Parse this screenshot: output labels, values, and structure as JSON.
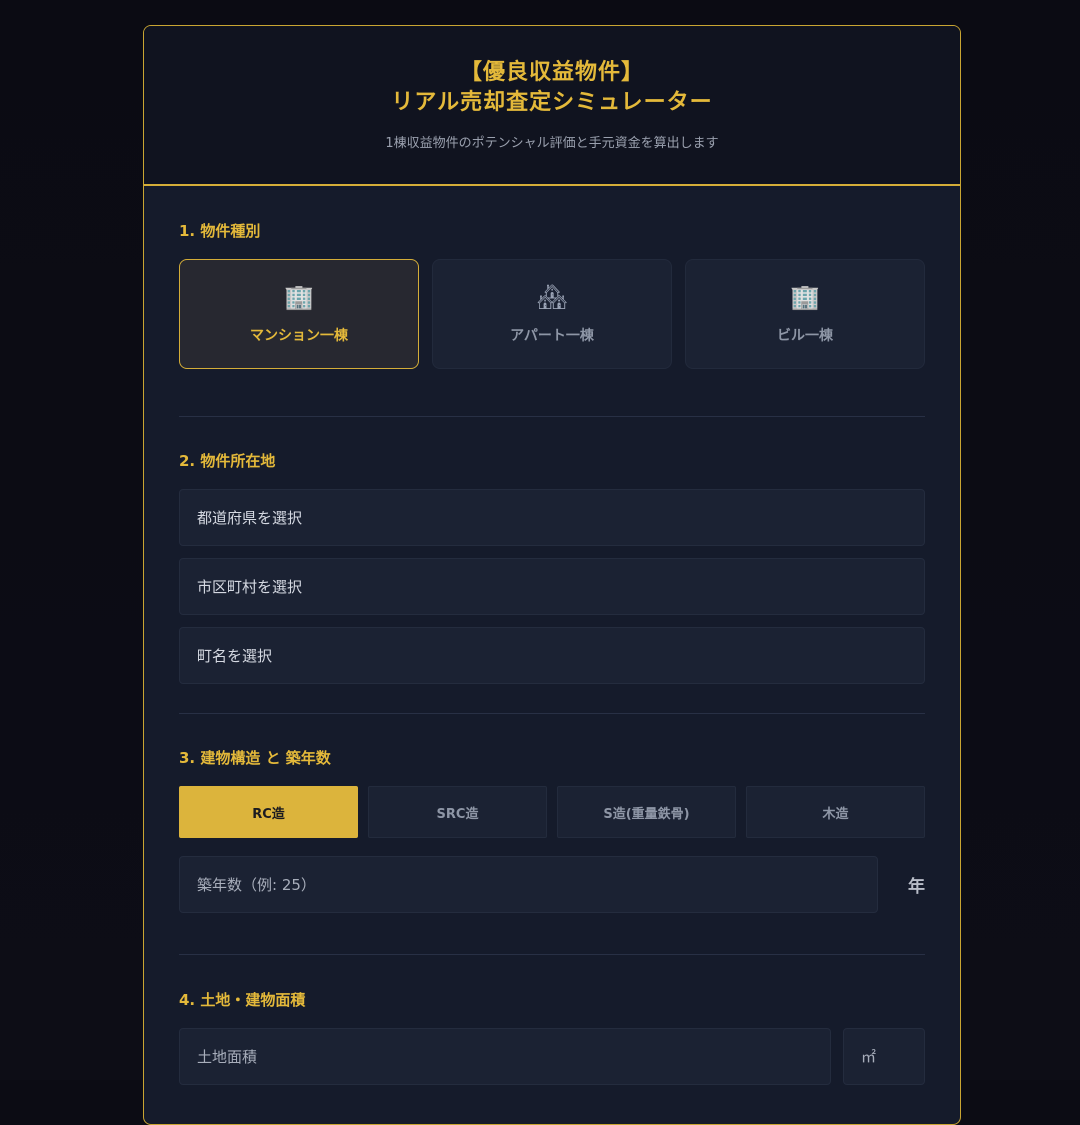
{
  "header": {
    "title_line1": "【優良収益物件】",
    "title_line2": "リアル売却査定シミュレーター",
    "subtitle": "1棟収益物件のポテンシャル評価と手元資金を算出します"
  },
  "section1": {
    "label": "1. 物件種別",
    "options": [
      {
        "icon": "building-icon",
        "glyph": "🏢",
        "label": "マンション一棟",
        "active": true
      },
      {
        "icon": "houses-icon",
        "glyph": "🏘",
        "label": "アパート一棟",
        "active": false
      },
      {
        "icon": "building-icon",
        "glyph": "🏢",
        "label": "ビル一棟",
        "active": false
      }
    ]
  },
  "section2": {
    "label": "2. 物件所在地",
    "prefecture": "都道府県を選択",
    "city": "市区町村を選択",
    "town": "町名を選択"
  },
  "section3": {
    "label": "3. 建物構造 と 築年数",
    "structures": [
      {
        "label": "RC造",
        "active": true
      },
      {
        "label": "SRC造",
        "active": false
      },
      {
        "label": "S造(重量鉄骨)",
        "active": false
      },
      {
        "label": "木造",
        "active": false
      }
    ],
    "age_placeholder": "築年数（例: 25）",
    "age_unit": "年"
  },
  "section4": {
    "label": "4. 土地・建物面積",
    "land_placeholder": "土地面積",
    "land_unit": "㎡"
  },
  "colors": {
    "accent": "#e4b93a",
    "background": "#0c0c14",
    "card": "#151b2b"
  }
}
